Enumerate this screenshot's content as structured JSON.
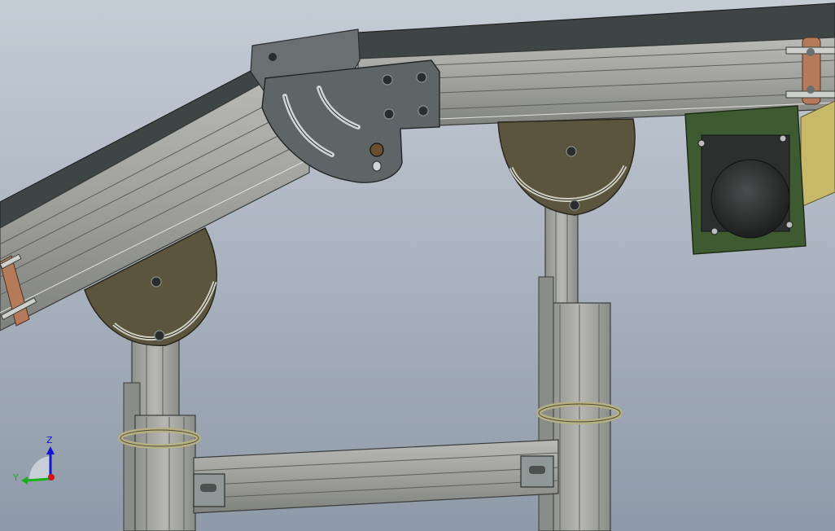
{
  "viewport": {
    "background_top": "#c4ccd6",
    "background_bottom": "#8f9aa8"
  },
  "colors": {
    "aluminum": "#a9aaa6",
    "aluminum_dark": "#6e716f",
    "aluminum_edge": "#3a3c3b",
    "belt": "#3f4444",
    "plate": "#5f6567",
    "cam_plate": "#5b553d",
    "motor_plate": "#3d5a30",
    "motor_body": "#2d2f2f",
    "bracket_copper": "#b57a5a",
    "leveling_ring": "#b6b082"
  },
  "triad": {
    "z_label": "Z",
    "y_label": "Y",
    "z_color": "#1414d2",
    "y_color": "#18b018",
    "x_color": "#d21414"
  }
}
